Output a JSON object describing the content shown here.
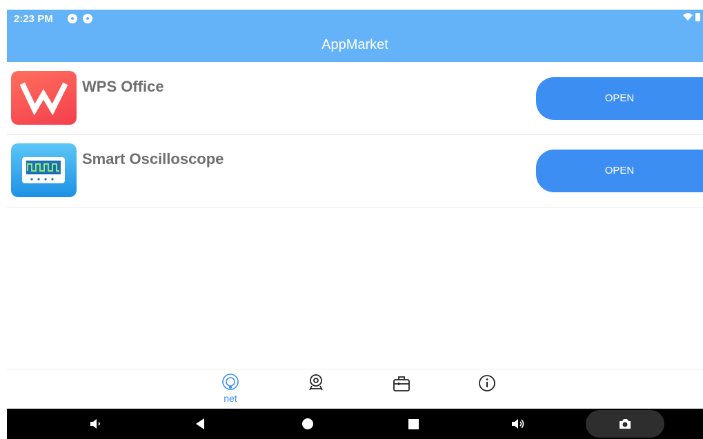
{
  "status_bar": {
    "time": "2:23 PM"
  },
  "header": {
    "title": "AppMarket"
  },
  "apps": [
    {
      "name": "WPS Office",
      "button": "OPEN",
      "icon": "wps-office-icon"
    },
    {
      "name": "Smart Oscilloscope",
      "button": "OPEN",
      "icon": "oscilloscope-icon"
    }
  ],
  "tabs": [
    {
      "label": "net",
      "icon": "net-icon",
      "active": true
    },
    {
      "label": "",
      "icon": "location-icon"
    },
    {
      "label": "",
      "icon": "briefcase-icon"
    },
    {
      "label": "",
      "icon": "info-icon"
    }
  ],
  "colors": {
    "accent": "#3d8ef2",
    "header": "#64b2f8"
  }
}
